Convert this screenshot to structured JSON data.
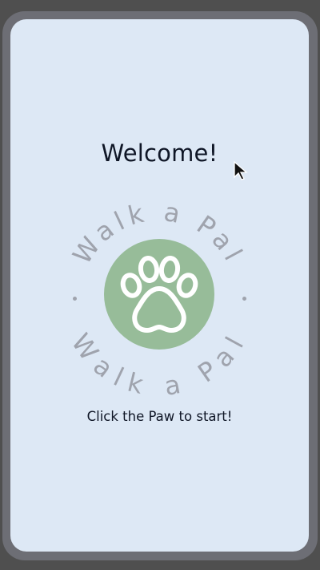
{
  "screen": {
    "title": "Welcome!",
    "badge_text_top": "Walk a Pal",
    "badge_text_bottom": "Walk a Pal",
    "instruction": "Click the Paw to start!"
  },
  "icons": {
    "paw": "paw-icon",
    "cursor": "mouse-pointer-icon"
  },
  "colors": {
    "background": "#dde8f5",
    "paw_circle": "#97bc99",
    "badge_text": "#9fa3ad",
    "text": "#0f1626",
    "frame": "#6d6e75"
  }
}
